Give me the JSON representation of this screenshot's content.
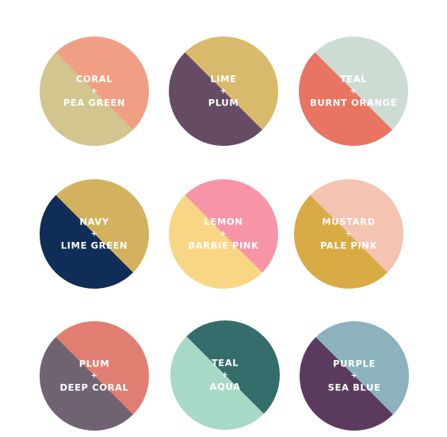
{
  "swatches": [
    {
      "top_label": "CORAL",
      "plus": "+",
      "bottom_label": "PEA GREEN",
      "color_a": "#f19f84",
      "color_b": "#d2c68e"
    },
    {
      "top_label": "LIME",
      "plus": "+",
      "bottom_label": "PLUM",
      "color_a": "#d9b96b",
      "color_b": "#654c64"
    },
    {
      "top_label": "TEAL",
      "plus": "+",
      "bottom_label": "BURNT ORANGE",
      "color_a": "#cddcd2",
      "color_b": "#e87461"
    },
    {
      "top_label": "NAVY",
      "plus": "+",
      "bottom_label": "LIME GREEN",
      "color_a": "#d2b25f",
      "color_b": "#0f2d56"
    },
    {
      "top_label": "LEMON",
      "plus": "+",
      "bottom_label": "BARBIE PINK",
      "color_a": "#f795a6",
      "color_b": "#f9d683"
    },
    {
      "top_label": "MUSTARD",
      "plus": "+",
      "bottom_label": "PALE PINK",
      "color_a": "#f4c3b1",
      "color_b": "#d9ab44"
    },
    {
      "top_label": "PLUM",
      "plus": "+",
      "bottom_label": "DEEP CORAL",
      "color_a": "#e07f71",
      "color_b": "#6f6372"
    },
    {
      "top_label": "TEAL",
      "plus": "+",
      "bottom_label": "AQUA",
      "color_a": "#356d6c",
      "color_b": "#a8d8c6"
    },
    {
      "top_label": "PURPLE",
      "plus": "+",
      "bottom_label": "SEA BLUE",
      "color_a": "#8cb3bd",
      "color_b": "#5b3b5d"
    }
  ]
}
